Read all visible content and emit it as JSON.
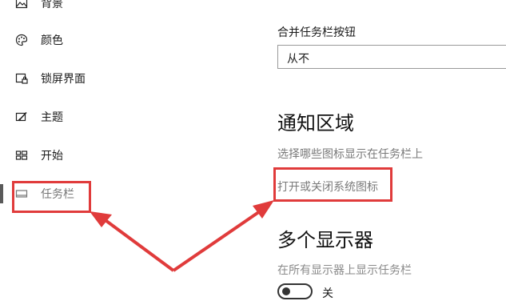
{
  "sidebar": {
    "items": [
      {
        "label": "背景",
        "icon": "image-icon"
      },
      {
        "label": "颜色",
        "icon": "palette-icon"
      },
      {
        "label": "锁屏界面",
        "icon": "lock-screen-icon"
      },
      {
        "label": "主题",
        "icon": "theme-brush-icon"
      },
      {
        "label": "开始",
        "icon": "start-menu-icon"
      },
      {
        "label": "任务栏",
        "icon": "taskbar-icon",
        "active": true
      }
    ]
  },
  "main": {
    "combine_label": "合并任务栏按钮",
    "combine_value": "从不",
    "notification_heading": "通知区域",
    "select_icons_link": "选择哪些图标显示在任务栏上",
    "system_icons_link": "打开或关闭系统图标",
    "multi_display_heading": "多个显示器",
    "show_all_displays_label": "在所有显示器上显示任务栏",
    "toggle_state": "关"
  },
  "annotation_color": "#e03b3b"
}
